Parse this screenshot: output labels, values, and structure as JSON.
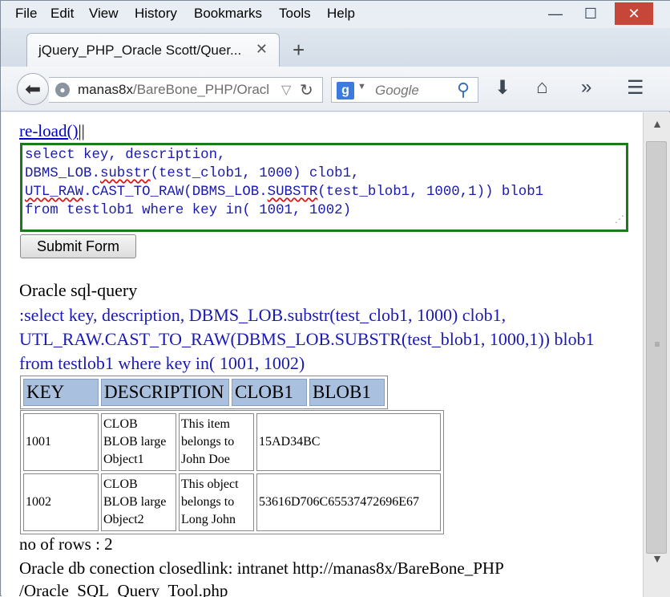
{
  "menu": {
    "file": "File",
    "edit": "Edit",
    "view": "View",
    "history": "History",
    "bookmarks": "Bookmarks",
    "tools": "Tools",
    "help": "Help"
  },
  "window_buttons": {
    "minimize": "—",
    "maximize": "☐",
    "close": "✕"
  },
  "tab": {
    "title": "jQuery_PHP_Oracle Scott/Quer...",
    "close": "✕"
  },
  "newtab": "+",
  "nav": {
    "url_host": "manas8x",
    "url_path": "/BareBone_PHP/Oracl",
    "search_engine": "g",
    "search_placeholder": "Google"
  },
  "page": {
    "clipped_line": "",
    "reload_link": "re-load()",
    "reload_sep": "||",
    "sql_lines": [
      "select key, description,",
      "DBMS_LOB.substr(test_clob1, 1000) clob1,",
      "UTL_RAW.CAST_TO_RAW(DBMS_LOB.SUBSTR(test_blob1, 1000,1)) blob1",
      "from testlob1 where key in( 1001, 1002)"
    ],
    "submit_label": "Submit Form",
    "query_title": "Oracle sql-query",
    "query_text": ":select key, description, DBMS_LOB.substr(test_clob1, 1000) clob1, UTL_RAW.CAST_TO_RAW(DBMS_LOB.SUBSTR(test_blob1, 1000,1)) blob1 from testlob1 where key in( 1001, 1002)",
    "table_headers": [
      "KEY",
      "DESCRIPTION",
      "CLOB1",
      "BLOB1"
    ],
    "rows": [
      {
        "key": "1001",
        "description": [
          "CLOB",
          "BLOB large",
          "Object1"
        ],
        "clob1": [
          "This item",
          "belongs to",
          "John Doe"
        ],
        "blob1": "15AD34BC"
      },
      {
        "key": "1002",
        "description": [
          "CLOB",
          "BLOB large",
          "Object2"
        ],
        "clob1": [
          "This object",
          "belongs to",
          "Long John"
        ],
        "blob1": "53616D706C65537472696E67"
      }
    ],
    "rows_count": "no of rows : 2",
    "closed_text": "Oracle db conection closedlink: intranet http://manas8x/BareBone_PHP",
    "cut_text": "/Oracle_SQL_Query_Tool.php"
  }
}
